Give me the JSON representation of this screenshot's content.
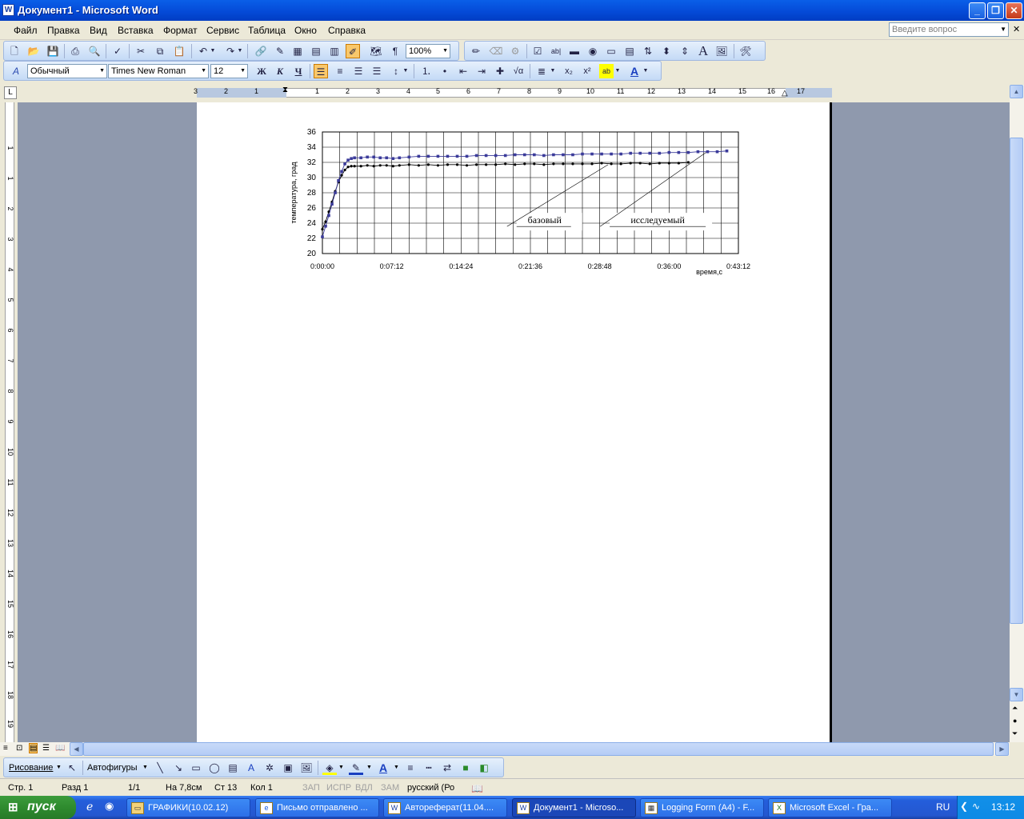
{
  "window": {
    "title": "Документ1 - Microsoft Word",
    "app_icon": "W",
    "controls": {
      "minimize": "_",
      "restore": "❐",
      "close": "✕"
    }
  },
  "menu": {
    "items": [
      "Файл",
      "Правка",
      "Вид",
      "Вставка",
      "Формат",
      "Сервис",
      "Таблица",
      "Окно",
      "Справка"
    ],
    "help_placeholder": "Введите вопрос"
  },
  "toolbar_standard": {
    "zoom": "100%"
  },
  "toolbar_formatting": {
    "style": "Обычный",
    "font": "Times New Roman",
    "size": "12",
    "bold": "Ж",
    "italic": "К",
    "underline": "Ч"
  },
  "ruler": {
    "h_numbers": [
      "3",
      "2",
      "1",
      "1",
      "2",
      "3",
      "4",
      "5",
      "6",
      "7",
      "8",
      "9",
      "10",
      "11",
      "12",
      "13",
      "14",
      "15",
      "16",
      "17"
    ],
    "v_numbers": [
      "1",
      "1",
      "2",
      "3",
      "4",
      "5",
      "6",
      "7",
      "8",
      "9",
      "10",
      "11",
      "12",
      "13",
      "14",
      "15",
      "16",
      "17",
      "18",
      "19",
      "20"
    ]
  },
  "chart_data": {
    "type": "scatter",
    "title": "",
    "xlabel": "время,с",
    "ylabel": "температура, град",
    "ylim": [
      20,
      36
    ],
    "yticks": [
      "20",
      "22",
      "24",
      "26",
      "28",
      "30",
      "32",
      "34",
      "36"
    ],
    "xticks": [
      "0:00:00",
      "0:07:12",
      "0:14:24",
      "0:21:36",
      "0:28:48",
      "0:36:00",
      "0:43:12"
    ],
    "xlim_seconds": [
      0,
      2592
    ],
    "grid": true,
    "series": [
      {
        "name": "базовый",
        "color": "#000000",
        "x_seconds": [
          0,
          20,
          40,
          60,
          80,
          100,
          120,
          140,
          160,
          180,
          200,
          240,
          280,
          320,
          360,
          400,
          440,
          480,
          540,
          600,
          660,
          720,
          780,
          840,
          900,
          960,
          1020,
          1080,
          1140,
          1200,
          1260,
          1320,
          1380,
          1440,
          1500,
          1560,
          1620,
          1680,
          1740,
          1800,
          1860,
          1920,
          1980,
          2040,
          2100,
          2160,
          2220,
          2280
        ],
        "values": [
          23.2,
          24.2,
          25.5,
          26.8,
          28.2,
          29.4,
          30.3,
          31.0,
          31.4,
          31.5,
          31.5,
          31.5,
          31.6,
          31.5,
          31.6,
          31.6,
          31.5,
          31.6,
          31.7,
          31.6,
          31.7,
          31.6,
          31.7,
          31.7,
          31.6,
          31.7,
          31.7,
          31.7,
          31.8,
          31.7,
          31.8,
          31.8,
          31.7,
          31.8,
          31.8,
          31.8,
          31.8,
          31.8,
          31.9,
          31.8,
          31.8,
          31.9,
          31.9,
          31.8,
          31.9,
          31.9,
          31.9,
          32.0
        ]
      },
      {
        "name": "исследуемый",
        "color": "#3b3b9a",
        "x_seconds": [
          0,
          20,
          40,
          60,
          80,
          100,
          120,
          140,
          160,
          180,
          200,
          240,
          280,
          320,
          360,
          400,
          440,
          480,
          540,
          600,
          660,
          720,
          780,
          840,
          900,
          960,
          1020,
          1080,
          1140,
          1200,
          1260,
          1320,
          1380,
          1440,
          1500,
          1560,
          1620,
          1680,
          1740,
          1800,
          1860,
          1920,
          1980,
          2040,
          2100,
          2160,
          2220,
          2280,
          2340,
          2400,
          2460,
          2520
        ],
        "values": [
          22.2,
          23.6,
          25.0,
          26.5,
          28.0,
          29.6,
          30.8,
          31.8,
          32.3,
          32.5,
          32.6,
          32.6,
          32.7,
          32.7,
          32.6,
          32.6,
          32.5,
          32.6,
          32.7,
          32.8,
          32.8,
          32.8,
          32.8,
          32.8,
          32.8,
          32.9,
          32.9,
          32.9,
          32.9,
          33.0,
          33.0,
          33.0,
          32.9,
          33.0,
          33.0,
          33.0,
          33.1,
          33.1,
          33.1,
          33.1,
          33.1,
          33.2,
          33.2,
          33.2,
          33.2,
          33.3,
          33.3,
          33.3,
          33.4,
          33.4,
          33.4,
          33.5
        ]
      }
    ],
    "annotations": [
      "базовый",
      "исследуемый"
    ]
  },
  "status": {
    "page": "Стр. 1",
    "section": "Разд 1",
    "pages": "1/1",
    "at": "На 7,8см",
    "line": "Ст 13",
    "col": "Кол 1",
    "rec": "ЗАП",
    "trk": "ИСПР",
    "ext": "ВДЛ",
    "ovr": "ЗАМ",
    "lang": "русский (Ро"
  },
  "drawing_toolbar": {
    "draw": "Рисование",
    "autoshapes": "Автофигуры"
  },
  "taskbar": {
    "start": "пуск",
    "tasks": [
      "ГРАФИКИ(10.02.12)",
      "Письмо отправлено ...",
      "Автореферат(11.04....",
      "Документ1 - Microso...",
      "Logging Form (A4) - F...",
      "Microsoft Excel - Гра..."
    ],
    "lang": "RU",
    "clock": "13:12"
  }
}
